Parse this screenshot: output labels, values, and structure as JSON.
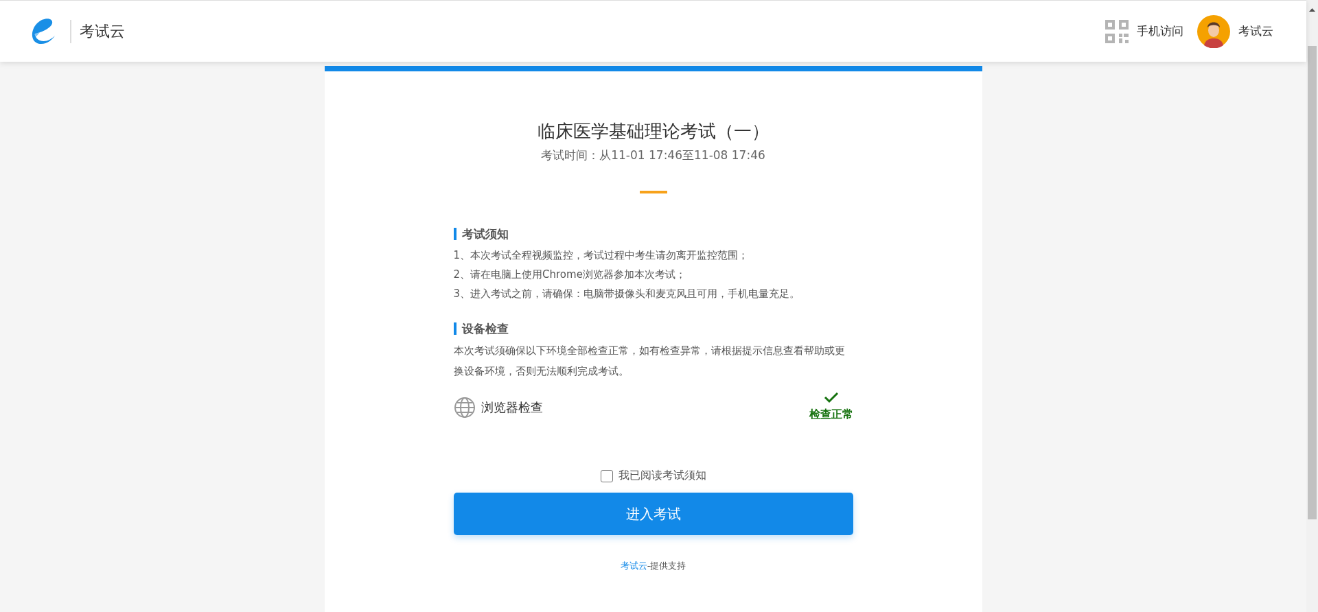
{
  "header": {
    "brand": "考试云",
    "mobile_access": "手机访问",
    "user_name": "考试云"
  },
  "exam": {
    "title": "临床医学基础理论考试（一）",
    "time": "考试时间：从11-01 17:46至11-08 17:46"
  },
  "notice": {
    "heading": "考试须知",
    "lines": [
      "1、本次考试全程视频监控，考试过程中考生请勿离开监控范围；",
      "2、请在电脑上使用Chrome浏览器参加本次考试；",
      "3、进入考试之前，请确保：电脑带摄像头和麦克风且可用，手机电量充足。"
    ]
  },
  "device_check": {
    "heading": "设备检查",
    "description": "本次考试须确保以下环境全部检查正常，如有检查异常，请根据提示信息查看帮助或更换设备环境，否则无法顺利完成考试。",
    "items": [
      {
        "label": "浏览器检查",
        "passed": true,
        "result": "检查正常"
      }
    ]
  },
  "agreement": {
    "label": "我已阅读考试须知",
    "checked": false
  },
  "enter_button": "进入考试",
  "footer": {
    "link": "考试云",
    "text": "-提供支持"
  }
}
